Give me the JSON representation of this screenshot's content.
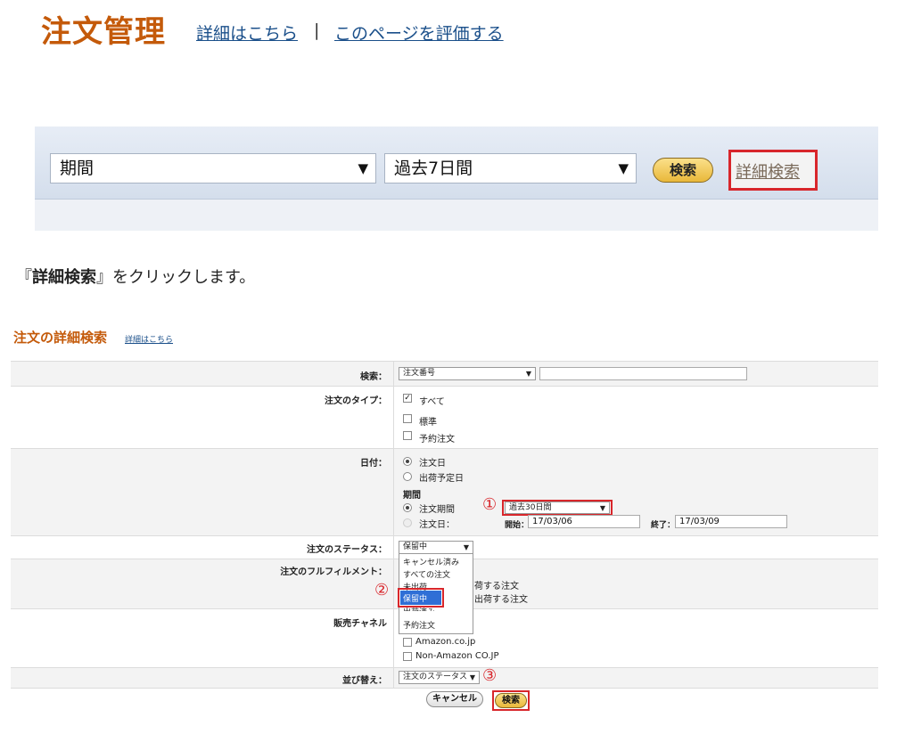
{
  "header": {
    "title": "注文管理",
    "link_details": "詳細はこちら",
    "separator": "|",
    "link_rate": "このページを評価する"
  },
  "top_filter": {
    "select1": "期間",
    "select2": "過去7日間",
    "search_button": "検索",
    "advanced_link": "詳細検索"
  },
  "instruction": {
    "open": "『",
    "bold": "詳細検索",
    "rest": "』をクリックします。"
  },
  "advanced": {
    "title": "注文の詳細検索",
    "help": "詳細はこちら",
    "search_label": "検索：",
    "search_select": "注文番号",
    "type_label": "注文のタイプ：",
    "type_all": "すべて",
    "type_standard": "標準",
    "type_preorder": "予約注文",
    "date_label": "日付：",
    "date_order": "注文日",
    "date_ship": "出荷予定日",
    "period_heading": "期間",
    "period_order": "注文期間",
    "period_select": "過去30日間",
    "period_date": "注文日：",
    "start_label": "開始：",
    "start_value": "17/03/06",
    "end_label": "終了：",
    "end_value": "17/03/09",
    "status_label": "注文のステータス：",
    "status_select": "保留中",
    "status_options": [
      "キャンセル済み",
      "すべての注文",
      "未出荷",
      "保留中",
      "出荷済み",
      "予約注文"
    ],
    "fulfillment_label": "注文のフルフィルメント：",
    "fulfill_opt1": "荷する注文",
    "fulfill_opt2": "出荷する注文",
    "channel_label": "販売チャネル",
    "channel_amazon": "Amazon.co.jp",
    "channel_non": "Non-Amazon CO.JP",
    "sort_label": "並び替え：",
    "sort_select": "注文のステータス",
    "cancel_button": "キャンセル",
    "search_button": "検索",
    "marker1": "①",
    "marker2": "②",
    "marker3": "③"
  },
  "colors": {
    "title": "#c45a0a",
    "link": "#1a4f8a",
    "highlight": "#d8262b",
    "button_gold": "#e9b83a"
  }
}
